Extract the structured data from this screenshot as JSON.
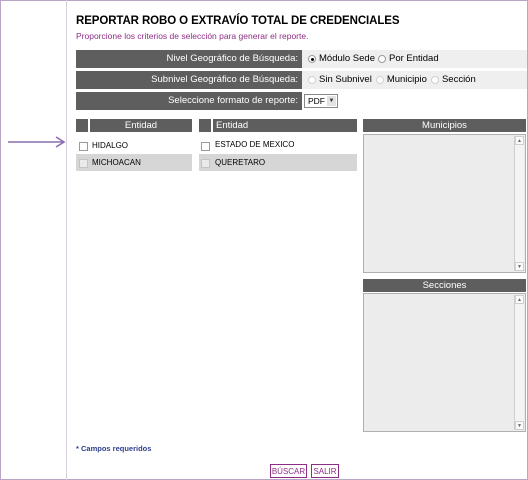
{
  "title": "REPORTAR ROBO O EXTRAVÍO TOTAL DE CREDENCIALES",
  "subtitle": "Proporcione los criterios de selección para generar el reporte.",
  "nivel": {
    "label": "Nivel Geográfico de Búsqueda:",
    "options": [
      "Módulo Sede",
      "Por Entidad"
    ],
    "selected": "Módulo Sede"
  },
  "subnivel": {
    "label": "Subnivel Geográfico de Búsqueda:",
    "options": [
      "Sin Subnivel",
      "Municipio",
      "Sección"
    ]
  },
  "formato": {
    "label": "Seleccione formato de reporte:",
    "value": "PDF"
  },
  "entidad_left": {
    "header": "Entidad",
    "rows": [
      "HIDALGO",
      "MICHOACAN"
    ]
  },
  "entidad_right": {
    "header": "Entidad",
    "rows": [
      "ESTADO DE MEXICO",
      "QUERETARO"
    ]
  },
  "municipios": {
    "header": "Municipios"
  },
  "secciones": {
    "header": "Secciones"
  },
  "required_note": "* Campos requeridos",
  "buttons": {
    "buscar": "BÚSCAR",
    "salir": "SALIR"
  },
  "colors": {
    "accent": "#8e2d86",
    "header": "#5e5e5e",
    "arrow": "#8a6fb0"
  },
  "icons": {
    "arrow": "arrow-right-icon"
  }
}
